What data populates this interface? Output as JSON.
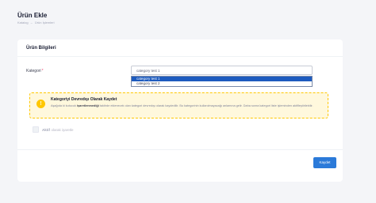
{
  "header": {
    "title": "Ürün Ekle",
    "breadcrumb": [
      "Katalog",
      "Ürün İşlemleri"
    ],
    "breadcrumb_separator": "–"
  },
  "card": {
    "title": "Ürün Bilgileri",
    "category_label": "Kategori",
    "required_mark": "*",
    "category_value": "category test 1",
    "category_options": [
      {
        "label": "category test 1",
        "selected": true
      },
      {
        "label": "category test 2",
        "selected": false
      }
    ],
    "alert": {
      "icon": "exclamation-icon",
      "icon_glyph": "!",
      "title": "Kategoriyi Devredışı Olarak Kaydet",
      "text_before": "Aşağıda ki kutucuk ",
      "text_bold": "işaretlenmediği",
      "text_after": " taktirde eklenecek olan kategori devredışı olarak kaydedilir. Bu kategorinin kullanılmayacağı anlamına gelir. Daha sonra kategori liste işleminden aktifleştirilebilir."
    },
    "active_checkbox": {
      "label_strong": "Aktif",
      "label_rest": "olarak işaretle",
      "checked": false
    },
    "save_label": "Kaydet"
  },
  "colors": {
    "accent": "#2b7ad9",
    "alert_bg": "#fff8dd",
    "alert_border": "#ffc700",
    "selected_option": "#1d5bbf"
  }
}
